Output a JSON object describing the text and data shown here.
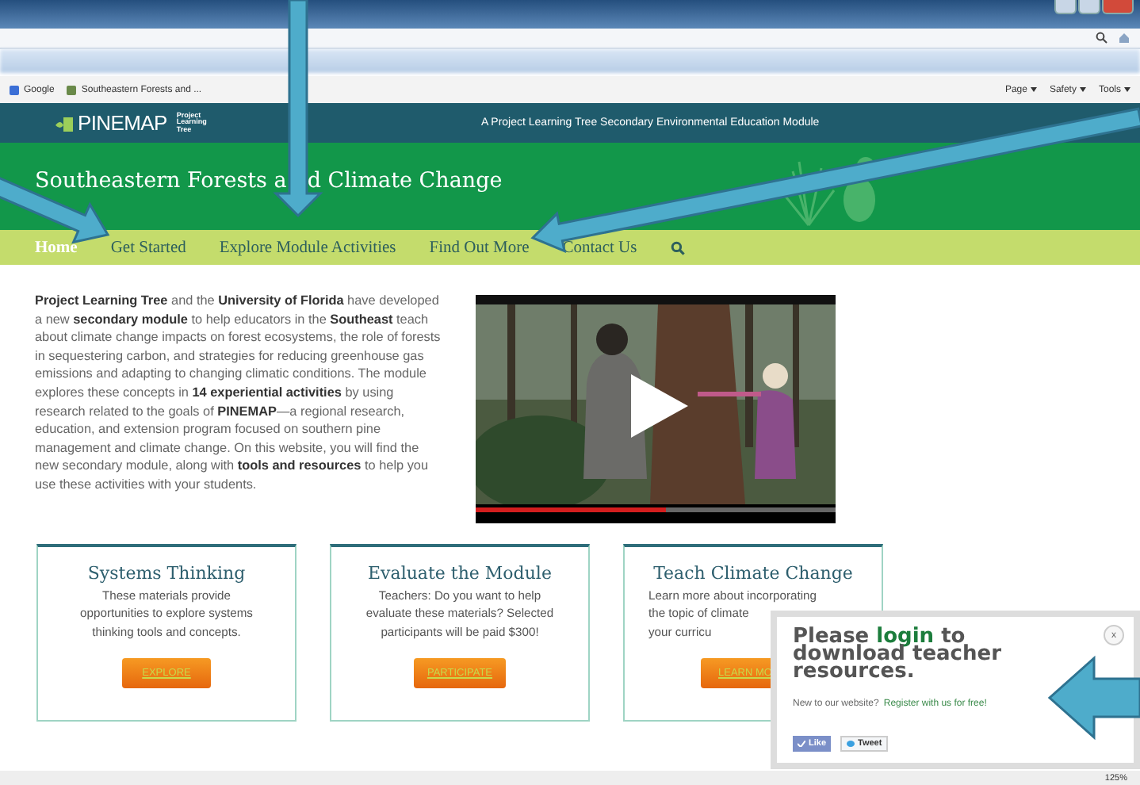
{
  "browser": {
    "favorites": [
      {
        "label": "Google"
      },
      {
        "label": "Southeastern Forests and ..."
      }
    ],
    "commands": [
      "Page",
      "Safety",
      "Tools"
    ],
    "zoom": "125%"
  },
  "site": {
    "logo": "PINEMAP",
    "partner_logo": [
      "Project",
      "Learning",
      "Tree"
    ],
    "tagline": "A Project Learning Tree Secondary Environmental Education Module"
  },
  "banner_title": [
    "Southeastern Forests a",
    "d Climate Change"
  ],
  "nav": [
    {
      "label": "Home",
      "selected": true
    },
    {
      "label": "Get Started",
      "selected": false
    },
    {
      "label": "Explore Module Activities",
      "selected": false
    },
    {
      "label": "Find Out More",
      "selected": false
    },
    {
      "label": "Contact Us",
      "selected": false
    }
  ],
  "intro": "**Project Learning Tree** and the **University of Florida** have developed a new **secondary module** to help educators in the **Southeast** teach about climate change impacts on forest ecosystems, the role of forests in sequestering carbon, and strategies for reducing greenhouse gas emissions and adapting to changing climatic conditions. The module explores these concepts in **14 experiential activities** by using research related to the goals of **PINEMAP**—a regional research, education, and extension program focused on southern pine management and climate change. On this website, you will find the new secondary module, along with **tools and resources** to help you use these activities with your students.",
  "video": {
    "level": 0.53
  },
  "cards": [
    {
      "title": "Systems Thinking",
      "lines": [
        "These materials provide",
        "opportunities to explore systems",
        "thinking tools and concepts."
      ],
      "button": "EXPLORE",
      "covered": false
    },
    {
      "title": "Evaluate the Module",
      "lines": [
        "Teachers: Do you want to help",
        "evaluate these materials? Selected",
        "participants will be paid $300!"
      ],
      "button": "PARTICIPATE",
      "covered": false
    },
    {
      "title": "Teach Climate Change",
      "lines": [
        "Learn more about incorporating",
        "the topic of climate",
        "your curricu"
      ],
      "button": "LEARN MO",
      "covered": true
    }
  ],
  "popup": {
    "heading": "Please **login** to download teacher resources.",
    "prompt": "New to our website?",
    "link": "Register with us for free!",
    "close": "x",
    "like": "Like",
    "tweet": "Tweet"
  }
}
